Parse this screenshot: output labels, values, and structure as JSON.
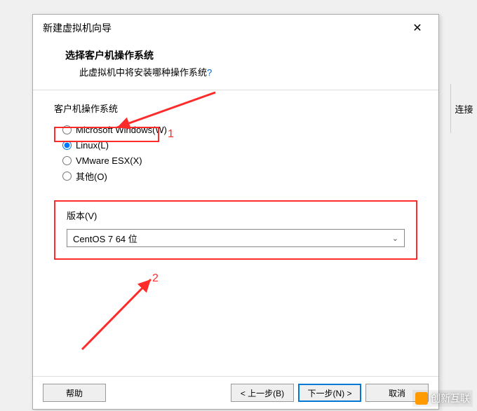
{
  "dialog": {
    "title": "新建虚拟机向导",
    "close_label": "✕"
  },
  "header": {
    "title": "选择客户机操作系统",
    "subtitle_prefix": "此虚拟机中将安装哪种操作系统",
    "subtitle_suffix": "?"
  },
  "os_group": {
    "label": "客户机操作系统",
    "options": {
      "windows": "Microsoft Windows(W)",
      "linux": "Linux(L)",
      "vmware_esx": "VMware ESX(X)",
      "other": "其他(O)"
    },
    "selected": "linux"
  },
  "version_group": {
    "label": "版本(V)",
    "selected": "CentOS 7 64 位"
  },
  "annotations": {
    "one": "1",
    "two": "2"
  },
  "buttons": {
    "help": "帮助",
    "back": "< 上一步(B)",
    "next": "下一步(N) >",
    "cancel": "取消"
  },
  "side": {
    "text": "连接"
  },
  "watermark": {
    "text": "创新互联"
  }
}
